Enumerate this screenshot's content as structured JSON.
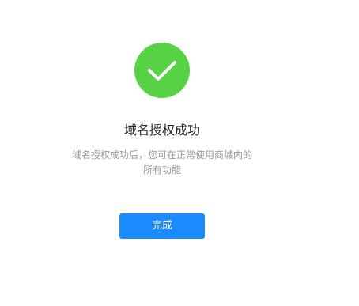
{
  "result": {
    "icon": "checkmark-icon",
    "icon_color": "#57d244",
    "title": "域名授权成功",
    "description_line1": "域名授权成功后，您可在正常使用商城内的",
    "description_line2": "所有功能"
  },
  "actions": {
    "done_label": "完成",
    "done_color": "#1a8cff"
  }
}
